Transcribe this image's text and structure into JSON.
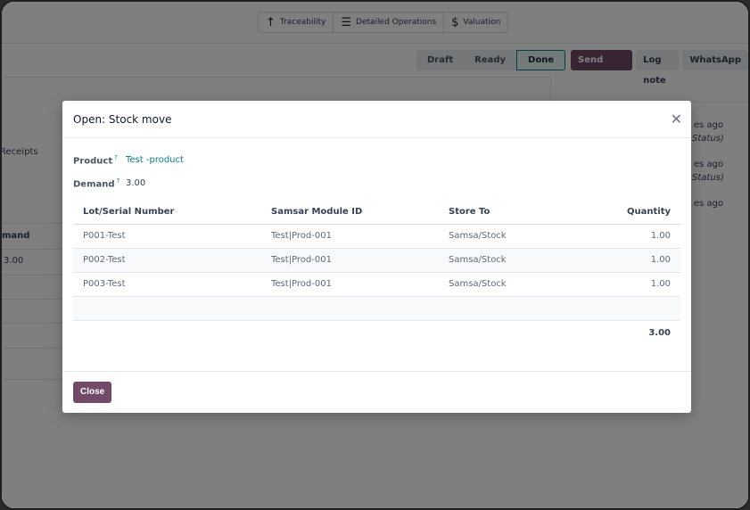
{
  "smart_buttons": [
    {
      "icon": "arrow-up-icon",
      "label": "Traceability"
    },
    {
      "icon": "list-icon",
      "label": "Detailed Operations"
    },
    {
      "icon": "dollar-icon",
      "label": "Valuation"
    }
  ],
  "statusbar": {
    "draft": "Draft",
    "ready": "Ready",
    "done": "Done"
  },
  "chatter": {
    "send_message": "Send message",
    "log_note": "Log note",
    "whatsapp": "WhatsApp",
    "log_items": [
      {
        "time": "es ago",
        "status": "Status)"
      },
      {
        "time": "es ago",
        "status": "Status)"
      },
      {
        "time": "es ago"
      }
    ]
  },
  "background": {
    "receipts": "Receipts",
    "demand_header": "mand",
    "demand_value": "3.00"
  },
  "modal": {
    "title": "Open: Stock move",
    "product_label": "Product",
    "product_value": "Test -product",
    "demand_label": "Demand",
    "demand_value": "3.00",
    "help_mark": "?",
    "columns": [
      "Lot/Serial Number",
      "Samsar Module ID",
      "Store To",
      "Quantity"
    ],
    "rows": [
      [
        "P001-Test",
        "Test|Prod-001",
        "Samsa/Stock",
        "1.00"
      ],
      [
        "P002-Test",
        "Test|Prod-001",
        "Samsa/Stock",
        "1.00"
      ],
      [
        "P003-Test",
        "Test|Prod-001",
        "Samsa/Stock",
        "1.00"
      ]
    ],
    "total": "3.00",
    "close_button": "Close"
  }
}
